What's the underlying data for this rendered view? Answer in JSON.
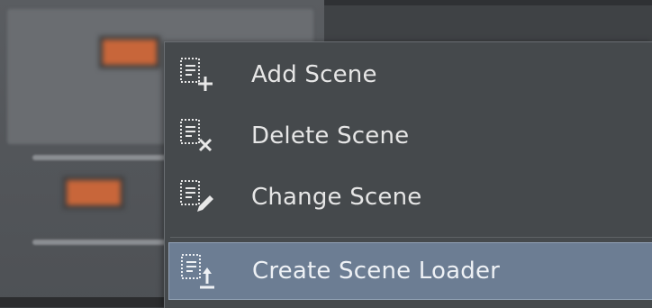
{
  "menu": {
    "items": [
      {
        "label": "Add Scene",
        "icon": "add-scene-icon"
      },
      {
        "label": "Delete Scene",
        "icon": "delete-scene-icon"
      },
      {
        "label": "Change Scene",
        "icon": "change-scene-icon"
      },
      {
        "label": "Create Scene Loader",
        "icon": "create-scene-loader-icon",
        "highlighted": true
      }
    ],
    "colors": {
      "background": "#45494c",
      "highlight": "#6c7d93",
      "text": "#e6e6e6"
    }
  }
}
